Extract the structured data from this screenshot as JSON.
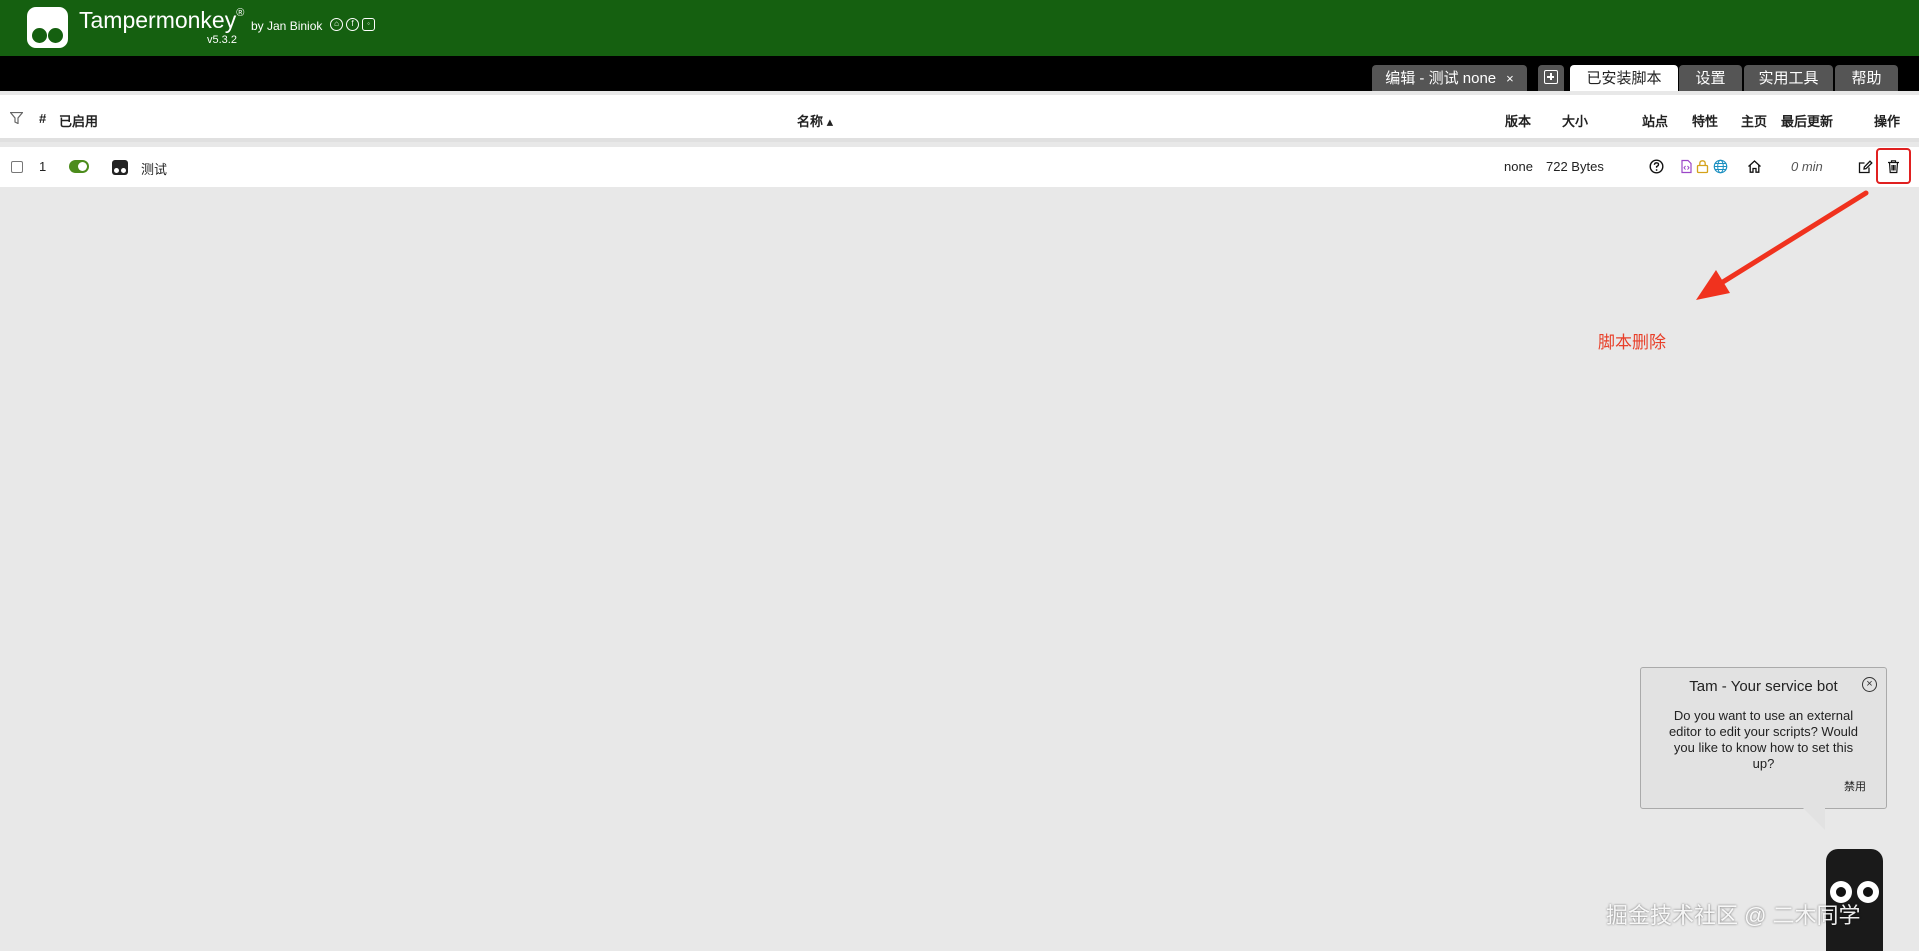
{
  "header": {
    "brand": "Tampermonkey",
    "trademark": "®",
    "byline": "by Jan Biniok",
    "version": "v5.3.2",
    "social_icons": [
      "github-icon",
      "facebook-icon",
      "instagram-icon"
    ]
  },
  "tabs": [
    {
      "label": "编辑 - 测试 none",
      "close": "×",
      "active": false
    },
    {
      "label": "已安装脚本",
      "active": true
    },
    {
      "label": "设置",
      "active": false
    },
    {
      "label": "实用工具",
      "active": false
    },
    {
      "label": "帮助",
      "active": false
    }
  ],
  "table": {
    "columns": {
      "index": "#",
      "enabled": "已启用",
      "name": "名称 ▴",
      "version": "版本",
      "size": "大小",
      "sites": "站点",
      "features": "特性",
      "homepage": "主页",
      "last_updated": "最后更新",
      "actions": "操作"
    },
    "rows": [
      {
        "index": "1",
        "enabled": true,
        "name": "测试",
        "version": "none",
        "size": "722 Bytes",
        "last_updated": "0 min"
      }
    ]
  },
  "annotation": {
    "text": "脚本删除",
    "color": "#e8402a"
  },
  "service_bot": {
    "title": "Tam - Your service bot",
    "message": "Do you want to use an external editor to edit your scripts? Would you like to know how to set this up?",
    "disable_label": "禁用"
  },
  "watermark": "掘金技术社区 @ 二木同学",
  "colors": {
    "header_bg": "#156010",
    "tabbar_bg": "#000000",
    "page_bg": "#e8e8e8",
    "toggle_on": "#4c8c1c",
    "highlight": "#e02020"
  }
}
